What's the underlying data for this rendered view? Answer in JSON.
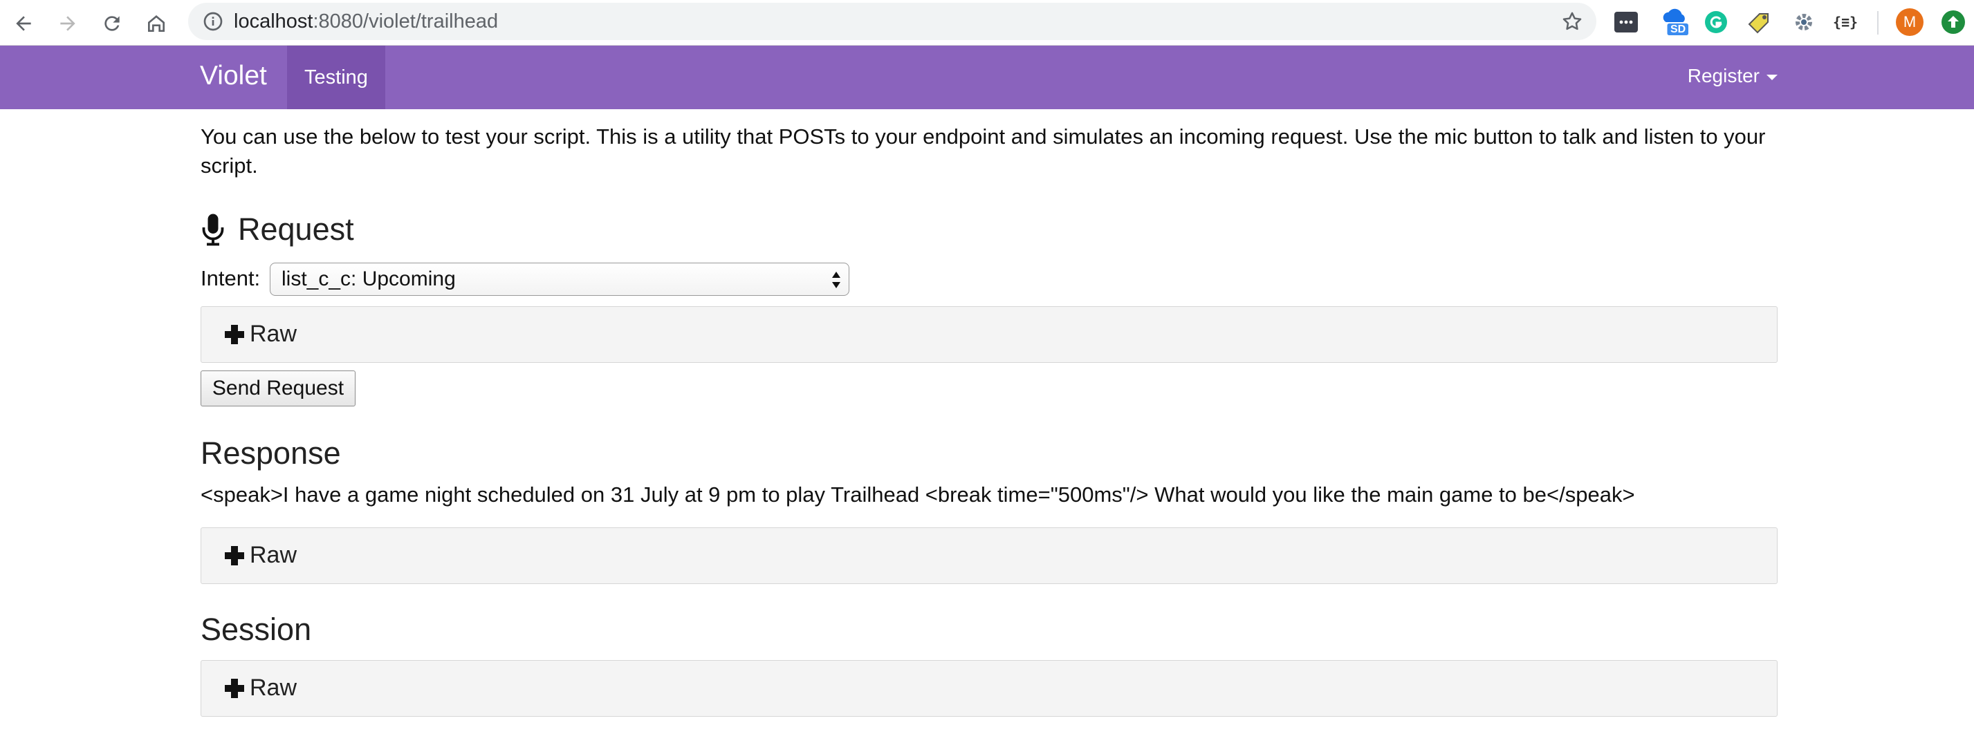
{
  "browser": {
    "url_host": "localhost",
    "url_path": ":8080/violet/trailhead",
    "profile_initial": "M",
    "ext_badge": "SD",
    "ext_json_label": "{≡}"
  },
  "navbar": {
    "brand": "Violet",
    "active_tab": "Testing",
    "register_label": "Register",
    "color": "#8a63bd",
    "active_color": "#7a52ad"
  },
  "main": {
    "intro": "You can use the below to test your script. This is a utility that POSTs to your endpoint and simulates an incoming request. Use the mic button to talk and listen to your script.",
    "request": {
      "heading": "Request",
      "intent_label": "Intent:",
      "intent_value": "list_c_c: Upcoming",
      "raw_label": "Raw",
      "send_label": "Send Request"
    },
    "response": {
      "heading": "Response",
      "text": "<speak>I have a game night scheduled on 31 July at 9 pm to play Trailhead <break time=\"500ms\"/> What would you like the main game to be</speak>",
      "raw_label": "Raw"
    },
    "session": {
      "heading": "Session",
      "raw_label": "Raw"
    }
  }
}
